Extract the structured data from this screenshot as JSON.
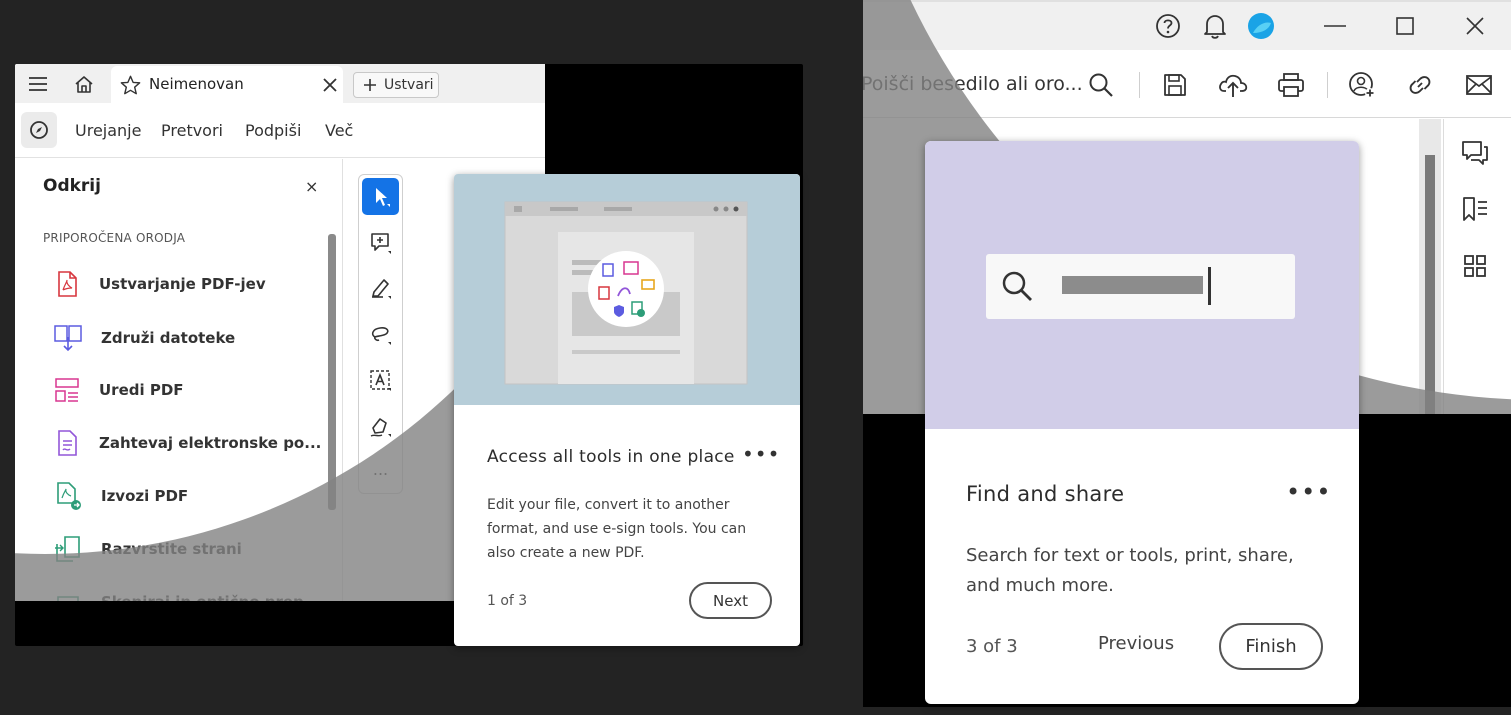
{
  "left_window": {
    "tab": {
      "title": "Neimenovan"
    },
    "create_button": "Ustvari",
    "menu": [
      "Urejanje",
      "Pretvori",
      "Podpiši",
      "Več"
    ],
    "discover": {
      "title": "Odkrij",
      "close": "×",
      "section_label": "PRIPOROČENA ORODJA",
      "tools": [
        {
          "label": "Ustvarjanje PDF-jev",
          "icon": "create-pdf-icon",
          "color": "#d7373f"
        },
        {
          "label": "Združi datoteke",
          "icon": "combine-files-icon",
          "color": "#5c5ce0"
        },
        {
          "label": "Uredi PDF",
          "icon": "edit-pdf-icon",
          "color": "#d83790"
        },
        {
          "label": "Zahtevaj elektronske po...",
          "icon": "request-esign-icon",
          "color": "#9256d9"
        },
        {
          "label": "Izvozi PDF",
          "icon": "export-pdf-icon",
          "color": "#2d9d78"
        },
        {
          "label": "Razvrstite strani",
          "icon": "organize-pages-icon",
          "color": "#2d9d78"
        },
        {
          "label": "Skeniraj in optično prep...",
          "icon": "scan-ocr-icon",
          "color": "#2d9d78"
        }
      ]
    },
    "toolbox": {
      "more": "..."
    }
  },
  "coach_card_1": {
    "title": "Access all tools in one place",
    "description": "Edit your file, convert it to another format, and use e-sign tools. You can also create a new PDF.",
    "step": "1 of 3",
    "next_label": "Next",
    "more": "•••",
    "hero_color": "#b6cdd8"
  },
  "right_window": {
    "search_placeholder": "Poišči besedilo ali oro...",
    "accent": "#1aa3e6"
  },
  "coach_card_2": {
    "title": "Find and share",
    "description": "Search for text or tools, print, share, and much more.",
    "step": "3 of 3",
    "previous_label": "Previous",
    "finish_label": "Finish",
    "more": "•••",
    "hero_color": "#d1cde8"
  }
}
